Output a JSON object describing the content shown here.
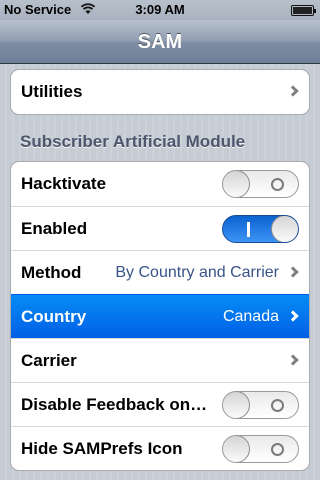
{
  "status_bar": {
    "carrier": "No Service",
    "wifi_icon": "wifi-icon",
    "time": "3:09 AM",
    "battery_icon": "battery-icon"
  },
  "nav": {
    "title": "SAM"
  },
  "top_group": {
    "utilities_label": "Utilities"
  },
  "section": {
    "header": "Subscriber Artificial Module"
  },
  "rows": {
    "hacktivate": {
      "label": "Hacktivate",
      "switch": "off"
    },
    "enabled": {
      "label": "Enabled",
      "switch": "on"
    },
    "method": {
      "label": "Method",
      "value": "By Country and Carrier"
    },
    "country": {
      "label": "Country",
      "value": "Canada",
      "selected": true
    },
    "carrier": {
      "label": "Carrier",
      "value": ""
    },
    "disable_feedback": {
      "label": "Disable Feedback on…",
      "switch": "off"
    },
    "hide_samprefs": {
      "label": "Hide SAMPrefs Icon",
      "switch": "off"
    }
  },
  "colors": {
    "selection_blue": "#015fe6",
    "switch_on_blue": "#2a7ee8",
    "value_text": "#385487",
    "section_header": "#4c566c"
  }
}
